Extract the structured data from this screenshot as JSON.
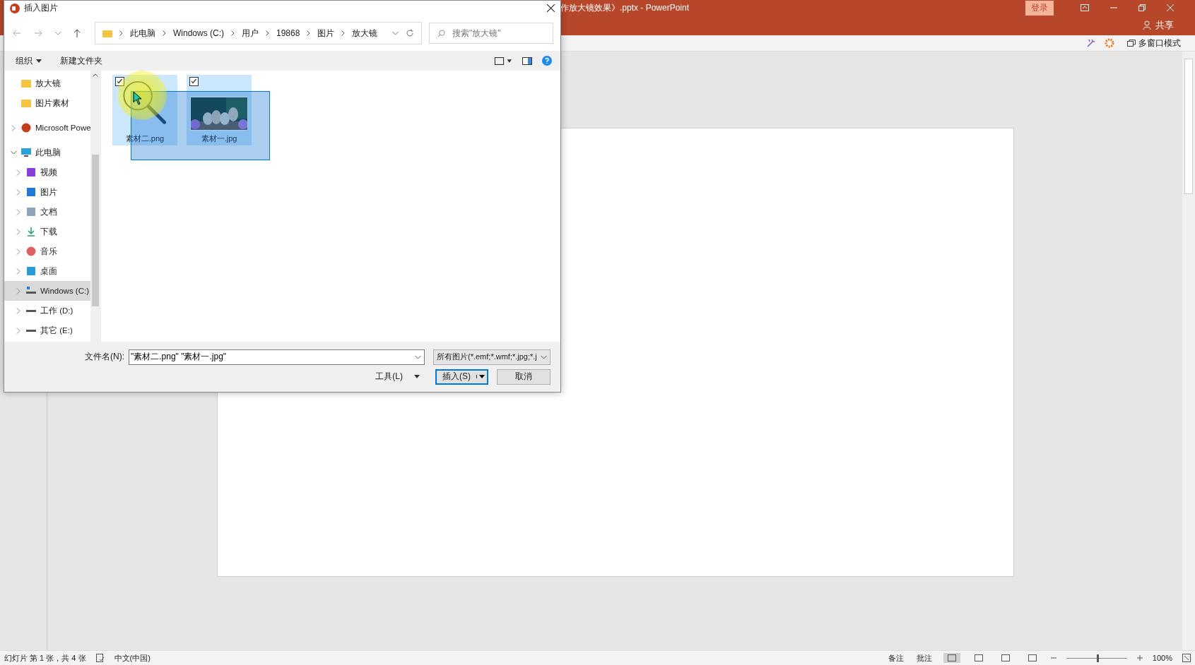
{
  "app": {
    "title": "作放大镜效果》.pptx  -  PowerPoint",
    "login": "登录",
    "share": "共享",
    "multi_window": "多窗口模式"
  },
  "dialog": {
    "title": "插入图片",
    "address": [
      "此电脑",
      "Windows (C:)",
      "用户",
      "19868",
      "图片",
      "放大镜"
    ],
    "search": {
      "placeholder": "搜索\"放大镜\""
    },
    "toolbar": [
      "组织",
      "新建文件夹"
    ],
    "nav": [
      {
        "label": "放大镜",
        "kind": "folder",
        "selected": false
      },
      {
        "label": "图片素材",
        "kind": "folder",
        "selected": false
      },
      {
        "label": "Microsoft Powe",
        "kind": "app",
        "selected": false,
        "expanded": false
      },
      {
        "label": "此电脑",
        "kind": "computer",
        "selected": false,
        "expanded": true,
        "children": [
          {
            "label": "视频",
            "kind": "video",
            "selected": false,
            "expanded": false
          },
          {
            "label": "图片",
            "kind": "pictures",
            "selected": false,
            "expanded": false
          },
          {
            "label": "文档",
            "kind": "documents",
            "selected": false,
            "expanded": false
          },
          {
            "label": "下载",
            "kind": "download",
            "selected": false,
            "expanded": false
          },
          {
            "label": "音乐",
            "kind": "music",
            "selected": false,
            "expanded": false
          },
          {
            "label": "桌面",
            "kind": "desktop",
            "selected": false,
            "expanded": false
          },
          {
            "label": "Windows (C:)",
            "kind": "system",
            "selected": true,
            "expanded": false
          },
          {
            "label": "工作 (D:)",
            "kind": "drive",
            "selected": false,
            "expanded": false
          },
          {
            "label": "其它 (E:)",
            "kind": "drive",
            "selected": false,
            "expanded": false
          }
        ]
      }
    ],
    "files": [
      {
        "name": "素材二.png",
        "kind": "icon",
        "selected": true,
        "checked": true
      },
      {
        "name": "素材一.jpg",
        "kind": "picture",
        "selected": true,
        "checked": true
      }
    ],
    "filename_label": "文件名(N):",
    "filename": "\"素材二.png\" \"素材一.jpg\"",
    "filetype": "所有图片(*.emf;*.wmf;*.jpg;*.j",
    "tools": "工具(L)",
    "insert": "插入(S)",
    "cancel": "取消"
  },
  "status_bar": {
    "slide_info": "幻灯片 第 1 张，共 4 张",
    "language": "中文(中国)",
    "notes": "备注",
    "comments": "批注",
    "views": [
      {
        "selected": true
      },
      {
        "selected": false
      },
      {
        "selected": false
      },
      {
        "selected": false
      }
    ],
    "zoom": {
      "level": 0.5
    },
    "zoom_text": "100%"
  }
}
